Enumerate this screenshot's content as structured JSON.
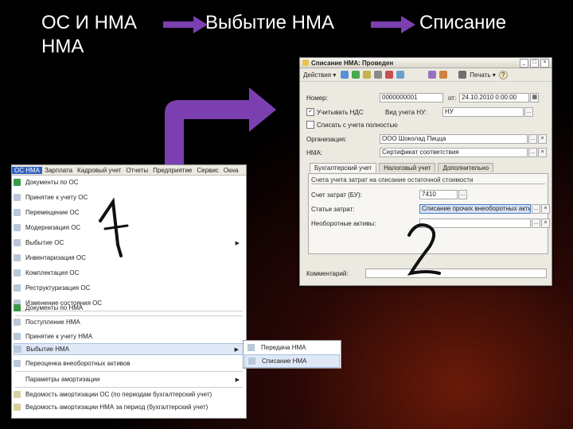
{
  "slide": {
    "title1": "ОС И НМА НМА",
    "title2": "Выбытие НМА",
    "title3": "Списание"
  },
  "window": {
    "title": "Списание НМА: Проведен",
    "toolbar": {
      "actions_label": "Действия ▾",
      "print_label": "Печать ▾",
      "help": "?"
    },
    "number_label": "Номер:",
    "number_value": "0000000001",
    "date_label": "от:",
    "date_value": "24.10.2010 0:00:00",
    "vat_label": "Учитывать НДС",
    "vat_checked": "✓",
    "account_type_label": "Вид учета НУ:",
    "account_type_value": "НУ",
    "writeoff_label": "Списать с учета полностью",
    "org_label": "Организация:",
    "org_value": "ООО Шоколад Пицца",
    "nma_label": "НМА:",
    "nma_value": "Сертификат соответствия",
    "tabs": [
      "Бухгалтерский учет",
      "Налоговый учет",
      "Дополнительно"
    ],
    "section_header": "Счета учета затрат на списание остаточной стоимости",
    "cost_account_label": "Счет затрат (БУ):",
    "cost_account_value": "7410",
    "expenses_label": "Статьи затрат:",
    "expenses_value": "Списание прочих внеоборотных активов фин",
    "nca_label": "Необоротные активы:",
    "comment_label": "Комментарий:"
  },
  "menu": {
    "bar": [
      "ОС НМА",
      "Зарплата",
      "Кадровый учет",
      "Отчеты",
      "Предприятие",
      "Сервис",
      "Окна"
    ],
    "items": [
      "Документы по ОС",
      "Принятие к учету ОС",
      "Перемещение ОС",
      "Модернизация ОС",
      "Выбытие ОС",
      "Инвентаризация ОС",
      "Комплектация ОС",
      "Реструктуризация ОС",
      "Изменение состояния ОС",
      "Документы по НМА",
      "Поступление НМА",
      "Принятие к учету НМА",
      "Выбытие НМА",
      "Переоценка внеоборотных активов",
      "Параметры амортизации",
      "Ведомость амортизации ОС (по периодам бухгалтерский учет)",
      "Ведомость амортизации НМА за период (бухгалтерский учет)"
    ],
    "submenu": [
      "Передача НМА",
      "Списание НМА"
    ]
  },
  "handwritten": {
    "one": "1",
    "two": "2"
  },
  "colors": {
    "arrow": "#7b3fb0",
    "accent": "#3060c0"
  }
}
